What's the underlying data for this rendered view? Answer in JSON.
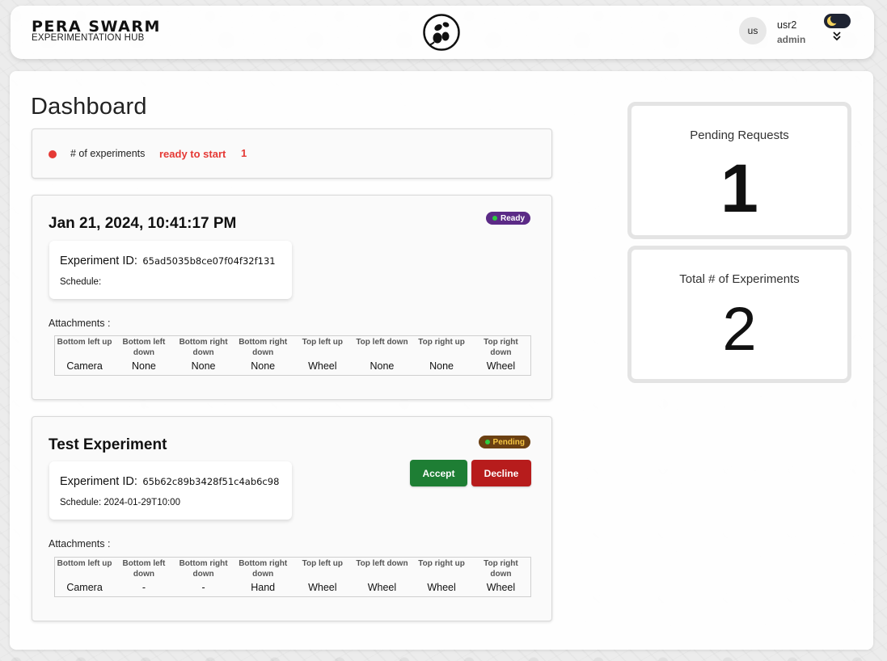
{
  "header": {
    "brand_title": "PERA SWARM",
    "brand_subtitle": "EXPERIMENTATION HUB",
    "logo_icon": "swarm-bee-logo",
    "avatar_initials": "us",
    "user_name": "usr2",
    "user_role": "admin",
    "theme_toggle_icon": "moon-icon",
    "expand_icon": "double-chevron-down-icon"
  },
  "page": {
    "title": "Dashboard"
  },
  "summary": {
    "label": "# of experiments",
    "status": "ready to start",
    "count": "1",
    "status_color": "#e53935"
  },
  "experiments": [
    {
      "title": "Jan 21, 2024, 10:41:17 PM",
      "badge": "Ready",
      "badge_color": "#5b2a86",
      "id_label": "Experiment ID:",
      "id_value": "65ad5035b8ce07f04f32f131",
      "schedule_label": "Schedule:",
      "attachments_label": "Attachments :",
      "attachments": {
        "headers": [
          "Bottom left up",
          "Bottom left down",
          "Bottom right down",
          "Bottom right down",
          "Top left up",
          "Top left down",
          "Top right up",
          "Top right down"
        ],
        "values": [
          "Camera",
          "None",
          "None",
          "None",
          "Wheel",
          "None",
          "None",
          "Wheel"
        ]
      }
    },
    {
      "title": "Test Experiment",
      "badge": "Pending",
      "badge_color": "#6b4012",
      "id_label": "Experiment ID:",
      "id_value": "65b62c89b3428f51c4ab6c98",
      "schedule_label": "Schedule: 2024-01-29T10:00",
      "accept_label": "Accept",
      "decline_label": "Decline",
      "attachments_label": "Attachments :",
      "attachments": {
        "headers": [
          "Bottom left up",
          "Bottom left down",
          "Bottom right down",
          "Bottom right down",
          "Top left up",
          "Top left down",
          "Top right up",
          "Top right down"
        ],
        "values": [
          "Camera",
          "-",
          "-",
          "Hand",
          "Wheel",
          "Wheel",
          "Wheel",
          "Wheel"
        ]
      }
    }
  ],
  "stats": {
    "pending_label": "Pending Requests",
    "pending_value": "1",
    "total_label": "Total # of Experiments",
    "total_value": "2"
  },
  "colors": {
    "accept": "#1e7e34",
    "decline": "#b71c1c"
  }
}
